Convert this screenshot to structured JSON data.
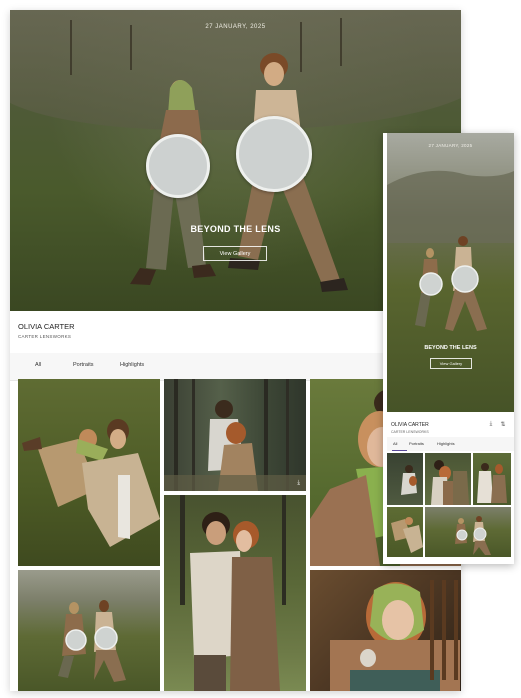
{
  "desktop": {
    "hero": {
      "date": "27 JANUARY, 2025",
      "title": "BEYOND THE LENS",
      "button_label": "View Gallery"
    },
    "profile": {
      "name": "OLIVIA CARTER",
      "studio": "CARTER LENSWORKS"
    },
    "tabs": [
      {
        "label": "All",
        "active": true
      },
      {
        "label": "Portraits",
        "active": false
      },
      {
        "label": "Highlights",
        "active": false
      }
    ],
    "accent_color": "#5a4a9a"
  },
  "mobile": {
    "hero": {
      "date": "27 JANUARY, 2025",
      "title": "BEYOND THE LENS",
      "button_label": "View Gallery"
    },
    "profile": {
      "name": "OLIVIA CARTER",
      "studio": "CARTER LENSWORKS"
    },
    "tabs": [
      {
        "label": "All",
        "active": true
      },
      {
        "label": "Portraits",
        "active": false
      },
      {
        "label": "Highlights",
        "active": false
      }
    ],
    "icons": [
      "download-icon",
      "sort-icon"
    ]
  }
}
